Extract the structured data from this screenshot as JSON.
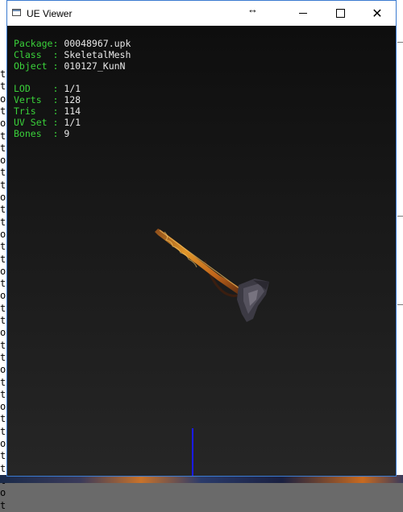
{
  "window": {
    "title": "UE Viewer",
    "controls": [
      "minimize",
      "maximize",
      "close"
    ]
  },
  "info": {
    "rows1": [
      {
        "key": "Package: ",
        "value": "00048967.upk"
      },
      {
        "key": "Class  : ",
        "value": "SkeletalMesh"
      },
      {
        "key": "Object : ",
        "value": "010127_KunN"
      }
    ],
    "rows2": [
      {
        "key": "LOD    : ",
        "value": "1/1"
      },
      {
        "key": "Verts  : ",
        "value": "128"
      },
      {
        "key": "Tris   : ",
        "value": "114"
      },
      {
        "key": "UV Set : ",
        "value": "1/1"
      },
      {
        "key": "Bones  : ",
        "value": "9"
      }
    ]
  },
  "background_text": {
    "letters": [
      "t",
      "t",
      "o",
      "t",
      "o",
      "t",
      "t",
      "o",
      "t",
      "t",
      "o",
      "t",
      "t",
      "o",
      "t",
      "t",
      "o",
      "t",
      "o",
      "t",
      "t",
      "o",
      "t",
      "t",
      "o",
      "t",
      "t",
      "o",
      "t",
      "t",
      "o",
      "t",
      "t",
      "t",
      "o",
      "t"
    ]
  },
  "colors": {
    "label": "#3ad23a",
    "value": "#e8e8e8",
    "axis": "#1a1aee"
  }
}
